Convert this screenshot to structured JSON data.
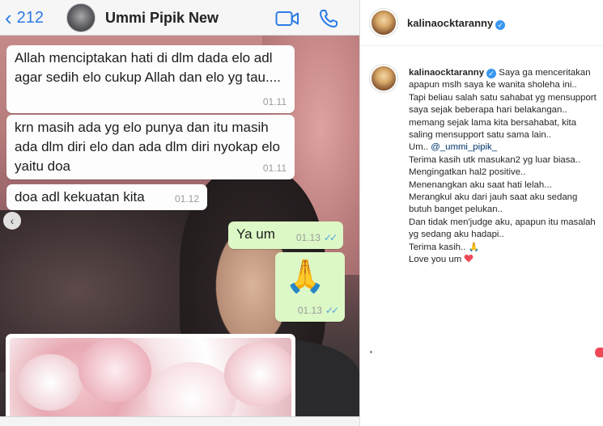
{
  "whatsapp": {
    "back_count": "212",
    "contact_name": "Ummi Pipik New",
    "messages": [
      {
        "text": "Allah menciptakan hati di dlm dada elo adl agar sedih elo cukup Allah dan elo yg tau....",
        "time": "01.11",
        "direction": "in"
      },
      {
        "text": "krn masih ada yg elo punya dan itu masih ada dlm diri elo dan ada dlm diri nyokap elo  yaitu doa",
        "time": "01.11",
        "direction": "in"
      },
      {
        "text": "doa adl kekuatan kita",
        "time": "01.12",
        "direction": "in"
      },
      {
        "text": "Ya um",
        "time": "01.13",
        "direction": "out"
      },
      {
        "text": "🙏",
        "time": "01.13",
        "direction": "out"
      }
    ]
  },
  "instagram": {
    "username": "kalinaocktaranny",
    "caption_lines": [
      "Saya ga menceritakan apapun mslh saya ke wanita sholeha ini..",
      "Tapi beliau salah satu sahabat yg mensupport saya sejak beberapa hari belakangan..",
      "memang sejak lama kita bersahabat, kita saling mensupport satu sama lain..",
      "Um.. ",
      "Terima kasih utk masukan2 yg luar biasa.. Mengingatkan hal2 positive..",
      "Menenangkan aku saat hati lelah...",
      "Merangkul aku dari jauh saat aku sedang butuh banget pelukan..",
      "Dan tidak men'judge aku, apapun itu masalah yg sedang aku hadapi..",
      "Terima kasih.. ",
      "Love you um "
    ],
    "mention": "@_ummi_pipik_",
    "colors": {
      "verified": "#3897f0",
      "mention": "#00376b",
      "heart": "#ed4956"
    }
  }
}
